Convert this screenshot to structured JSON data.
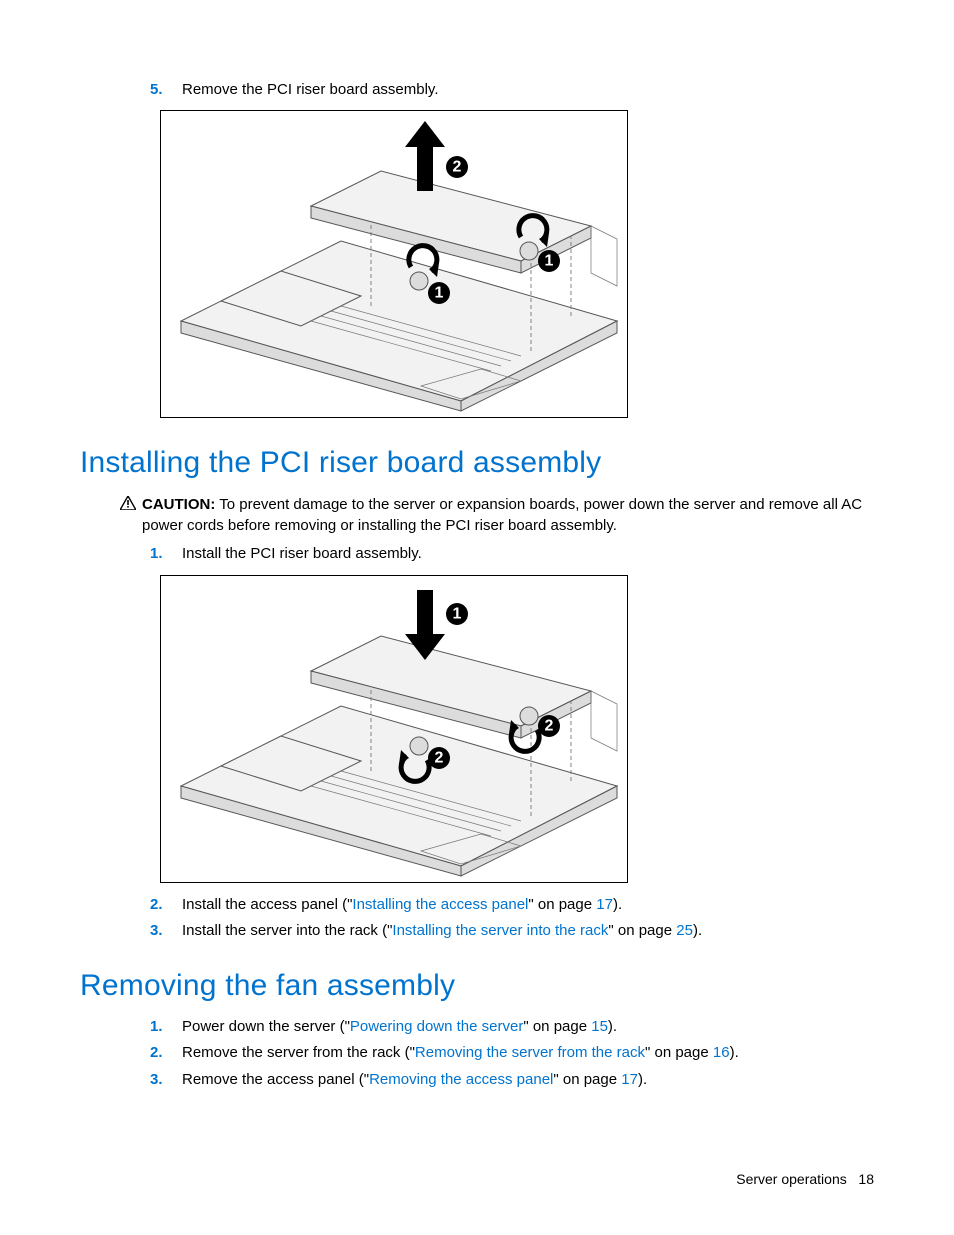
{
  "step5": {
    "num": "5.",
    "text": "Remove the PCI riser board assembly."
  },
  "heading_install": "Installing the PCI riser board assembly",
  "caution": {
    "label": "CAUTION:",
    "text": " To prevent damage to the server or expansion boards, power down the server and remove all AC power cords before removing or installing the PCI riser board assembly."
  },
  "install_steps": [
    {
      "num": "1.",
      "pre": "Install the PCI riser board assembly."
    },
    {
      "num": "2.",
      "pre": "Install the access panel (\"",
      "link": "Installing the access panel",
      "post": "\" on page ",
      "page": "17",
      "end": ")."
    },
    {
      "num": "3.",
      "pre": "Install the server into the rack (\"",
      "link": "Installing the server into the rack",
      "post": "\" on page ",
      "page": "25",
      "end": ")."
    }
  ],
  "heading_fan": "Removing the fan assembly",
  "fan_steps": [
    {
      "num": "1.",
      "pre": "Power down the server (\"",
      "link": "Powering down the server",
      "post": "\" on page ",
      "page": "15",
      "end": ")."
    },
    {
      "num": "2.",
      "pre": "Remove the server from the rack (\"",
      "link": "Removing the server from the rack",
      "post": "\" on page ",
      "page": "16",
      "end": ")."
    },
    {
      "num": "3.",
      "pre": "Remove the access panel (\"",
      "link": "Removing the access panel",
      "post": "\" on page ",
      "page": "17",
      "end": ")."
    }
  ],
  "footer": {
    "section": "Server operations",
    "page": "18"
  },
  "diagram_remove": {
    "callouts": [
      "1",
      "1",
      "2"
    ]
  },
  "diagram_install": {
    "callouts": [
      "1",
      "2",
      "2"
    ]
  }
}
